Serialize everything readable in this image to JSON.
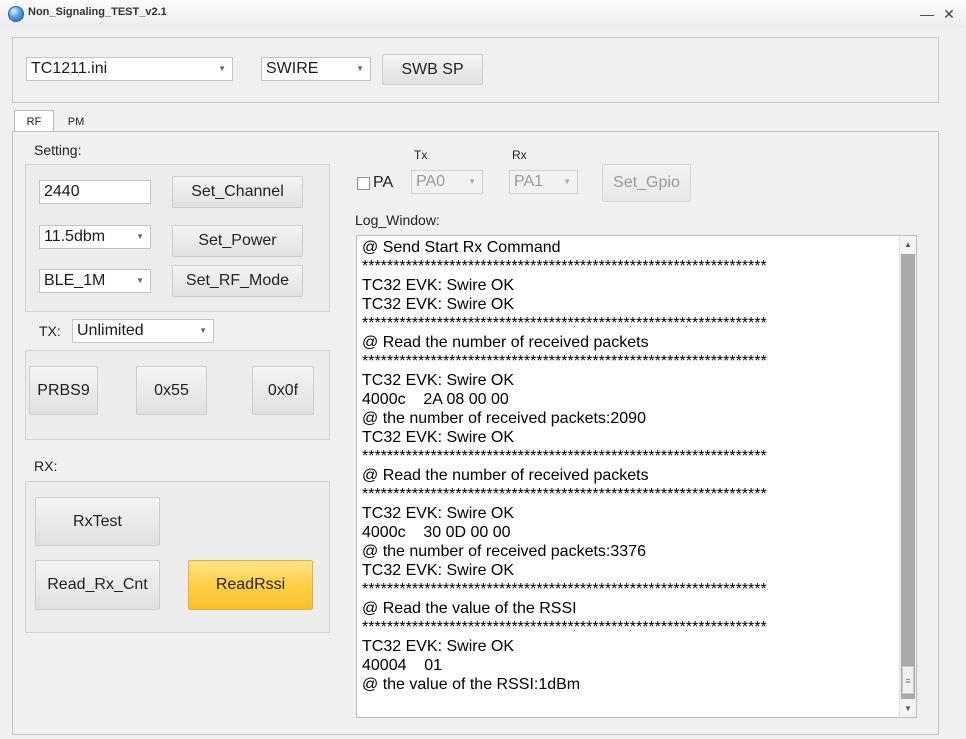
{
  "window": {
    "title": "Non_Signaling_TEST_v2.1",
    "minimize_glyph": "—",
    "close_glyph": "✕"
  },
  "header": {
    "config_file": "TC1211.ini",
    "interface": "SWIRE",
    "swb_sp_label": "SWB SP"
  },
  "tabs": [
    {
      "label": "RF"
    },
    {
      "label": "PM"
    }
  ],
  "setting": {
    "title": "Setting:",
    "channel_value": "2440",
    "set_channel_label": "Set_Channel",
    "power_value": "11.5dbm",
    "set_power_label": "Set_Power",
    "rf_mode_value": "BLE_1M",
    "set_rf_mode_label": "Set_RF_Mode"
  },
  "tx": {
    "label": "TX:",
    "mode_value": "Unlimited",
    "prbs9_label": "PRBS9",
    "x55_label": "0x55",
    "x0f_label": "0x0f"
  },
  "rx": {
    "label": "RX:",
    "rxtest_label": "RxTest",
    "read_rx_cnt_label": "Read_Rx_Cnt",
    "read_rssi_label": "ReadRssi"
  },
  "gpio": {
    "pa_label": "PA",
    "tx_header": "Tx",
    "rx_header": "Rx",
    "tx_pin": "PA0",
    "rx_pin": "PA1",
    "set_gpio_label": "Set_Gpio"
  },
  "log": {
    "title": "Log_Window:",
    "lines": [
      "@ Send Start Rx Command",
      "*****************************************************************",
      "TC32 EVK: Swire OK",
      "TC32 EVK: Swire OK",
      "*****************************************************************",
      "@ Read the number of received packets",
      "*****************************************************************",
      "TC32 EVK: Swire OK",
      "4000c    2A 08 00 00",
      "@ the number of received packets:2090",
      "TC32 EVK: Swire OK",
      "*****************************************************************",
      "@ Read the number of received packets",
      "*****************************************************************",
      "TC32 EVK: Swire OK",
      "4000c    30 0D 00 00",
      "@ the number of received packets:3376",
      "TC32 EVK: Swire OK",
      "*****************************************************************",
      "@ Read the value of the RSSI",
      "*****************************************************************",
      "TC32 EVK: Swire OK",
      "40004    01",
      "@ the value of the RSSI:1dBm"
    ]
  }
}
